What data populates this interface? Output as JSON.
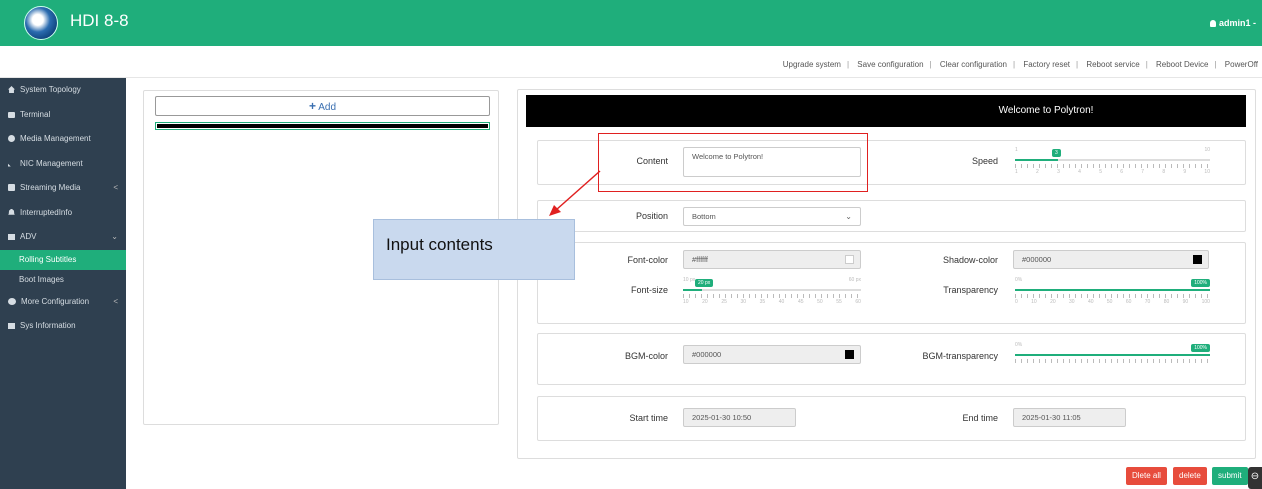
{
  "header": {
    "title": "HDI 8-8",
    "user": "admin1 -"
  },
  "actions": [
    "Upgrade system",
    "Save configuration",
    "Clear configuration",
    "Factory reset",
    "Reboot service",
    "Reboot Device",
    "PowerOff"
  ],
  "sidebar": {
    "items": [
      {
        "label": "System Topology",
        "icon": "home-icon"
      },
      {
        "label": "Terminal",
        "icon": "monitor-icon"
      },
      {
        "label": "Media Management",
        "icon": "disc-icon"
      },
      {
        "label": "NIC Management",
        "icon": "rss-icon"
      },
      {
        "label": "Streaming Media",
        "icon": "film-icon",
        "caret": "<"
      },
      {
        "label": "InterruptedInfo",
        "icon": "bell-icon"
      },
      {
        "label": "ADV",
        "icon": "list-icon",
        "caret": "⌄"
      },
      {
        "label": "More Configuration",
        "icon": "cogs-icon",
        "caret": "<"
      },
      {
        "label": "Sys Information",
        "icon": "table-icon"
      }
    ],
    "adv_sub": [
      "Rolling Subtitles",
      "Boot Images"
    ],
    "active": "Rolling Subtitles"
  },
  "left": {
    "add_label": "Add"
  },
  "preview": {
    "text": "Welcome to Polytron!"
  },
  "form": {
    "content_label": "Content",
    "content_value": "Welcome to Polytron!",
    "speed_label": "Speed",
    "speed": {
      "min": "1",
      "max": "10",
      "value": "3",
      "ticks": [
        "1",
        "2",
        "3",
        "4",
        "5",
        "6",
        "7",
        "8",
        "9",
        "10"
      ]
    },
    "position_label": "Position",
    "position_value": "Bottom",
    "font_color_label": "Font-color",
    "font_color_value": "#ffffff",
    "shadow_color_label": "Shadow-color",
    "shadow_color_value": "#000000",
    "font_size_label": "Font-size",
    "font_size": {
      "min": "10 px",
      "max": "60 px",
      "value": "20 px",
      "ticks": [
        "10",
        "20",
        "25",
        "30",
        "35",
        "40",
        "45",
        "50",
        "55",
        "60"
      ]
    },
    "transparency_label": "Transparency",
    "transparency": {
      "min": "0%",
      "max": "100%",
      "value": "100%",
      "ticks": [
        "0",
        "10",
        "20",
        "30",
        "40",
        "50",
        "60",
        "70",
        "80",
        "90",
        "100"
      ]
    },
    "bgm_color_label": "BGM-color",
    "bgm_color_value": "#000000",
    "bgm_transparency_label": "BGM-transparency",
    "bgm_transparency": {
      "min": "0%",
      "max": "100%",
      "value": "100%"
    },
    "start_label": "Start time",
    "start_value": "2025-01-30 10:50",
    "end_label": "End time",
    "end_value": "2025-01-30 11:05"
  },
  "annotation": {
    "text": "Input contents"
  },
  "buttons": {
    "delete_all": "Dlete all",
    "delete": "delete",
    "submit": "submit"
  },
  "colors": {
    "accent": "#1fae7b",
    "sidebar": "#2f4050",
    "danger": "#e74c3c",
    "callout": "#e02020"
  }
}
